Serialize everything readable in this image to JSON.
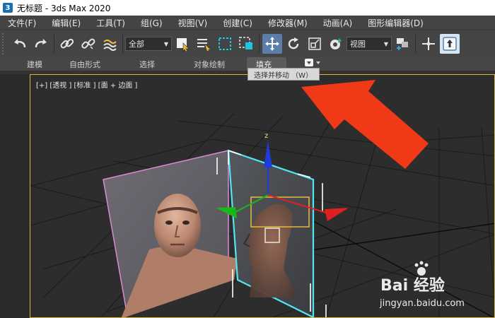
{
  "window": {
    "title": "无标题 - 3ds Max 2020",
    "logo_text": "3"
  },
  "menu": [
    {
      "label": "文件(F)"
    },
    {
      "label": "编辑(E)"
    },
    {
      "label": "工具(T)"
    },
    {
      "label": "组(G)"
    },
    {
      "label": "视图(V)"
    },
    {
      "label": "创建(C)"
    },
    {
      "label": "修改器(M)"
    },
    {
      "label": "动画(A)"
    },
    {
      "label": "图形编辑器(D)"
    }
  ],
  "toolbar": {
    "selection_filter": "全部",
    "reference_coord": "视图"
  },
  "ribbon": {
    "tabs": [
      "建模",
      "自由形式",
      "选择",
      "对象绘制",
      "填充"
    ]
  },
  "tooltip": {
    "text": "选择并移动 （W）"
  },
  "viewport": {
    "label": "[+] [透视 ] [标准 ] [面 + 边面 ]"
  },
  "gizmo": {
    "axis_z": "z"
  },
  "watermark": {
    "brand": "Bai 经验",
    "url": "jingyan.baidu.com"
  },
  "colors": {
    "accent_arrow": "#f03a17",
    "viewport_border": "#d6b83a",
    "active_button": "#5a7ea8",
    "selection_plane": "#52e6f2",
    "axis_x": "#e02020",
    "axis_y": "#18b818",
    "axis_z": "#1f3bdc"
  }
}
